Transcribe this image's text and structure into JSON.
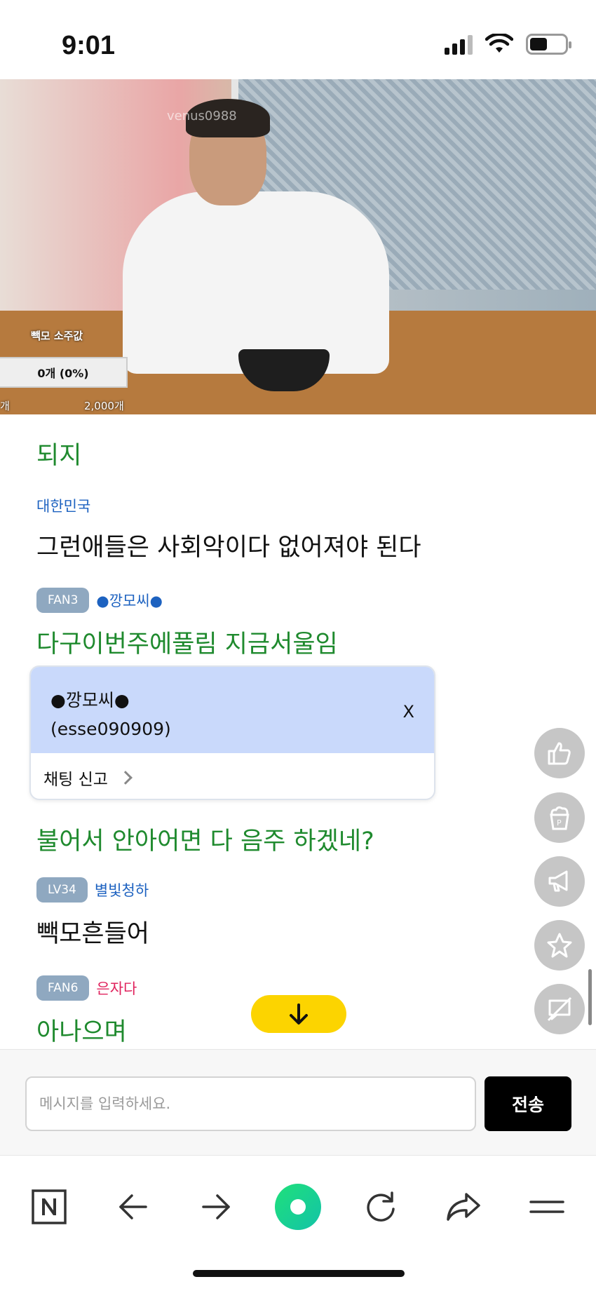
{
  "status_bar": {
    "time": "9:01"
  },
  "video": {
    "watermark": "venus0988",
    "overlay_label": "빽모 소주값",
    "overlay_vote": "0개 (0%)",
    "overlay_goal": "2,000개",
    "overlay_left": "개"
  },
  "chat": {
    "messages": [
      {
        "text": "되지"
      },
      {
        "nick": "대한민국",
        "text": "그런애들은 사회악이다 없어져야 된다"
      },
      {
        "badge": "FAN3",
        "nick": "●깡모씨●",
        "text": "다구이번주에풀림 지금서울임"
      },
      {
        "text": "불어서 안아어면 다 음주 하겠네?"
      },
      {
        "badge": "LV34",
        "nick": "별빛청하",
        "text": "빽모흔들어"
      },
      {
        "badge": "FAN6",
        "nick": "은자다",
        "text": "아나으며"
      }
    ],
    "popup": {
      "name": "●깡모씨●",
      "id": "(esse090909)",
      "close": "X",
      "report": "채팅 신고"
    }
  },
  "side_buttons": [
    "thumbs-up-icon",
    "popcorn-icon",
    "megaphone-icon",
    "star-icon",
    "chat-off-icon"
  ],
  "input": {
    "placeholder": "메시지를 입력하세요.",
    "send_label": "전송"
  },
  "bottom_nav": [
    "naver-icon",
    "back-arrow-icon",
    "forward-arrow-icon",
    "green-dot-icon",
    "reload-icon",
    "share-icon",
    "menu-icon"
  ],
  "colors": {
    "chat_green": "#1f8a2e",
    "nick_blue": "#1d62c0",
    "nick_pink": "#e0245e",
    "badge": "#8fa8c0",
    "popup_bg": "#c9d9fb",
    "scroll_btn": "#fcd400",
    "live_green": "#1fd17a"
  }
}
